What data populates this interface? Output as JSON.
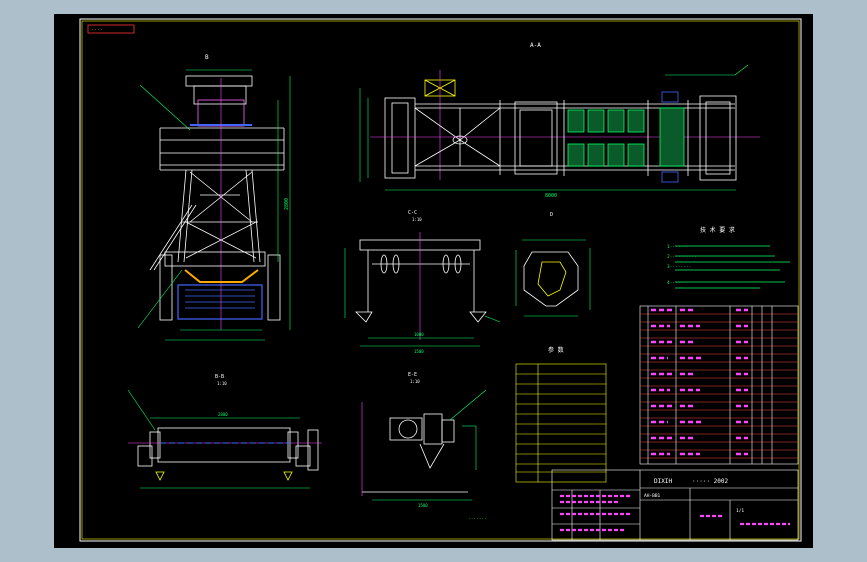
{
  "title_tag": "····",
  "views": {
    "side_label": "B",
    "top_label": "A-A",
    "cc_label": "C-C",
    "dd_label": "D",
    "bb_label": "B-B",
    "ee_label": "E-E",
    "scale": "1:10"
  },
  "dims": {
    "top_total": "8000",
    "side_h": "2800",
    "cc_w1": "1000",
    "cc_w2": "1500",
    "bb_w": "2800",
    "ee_w": "1500"
  },
  "tech_title": "技 术 要 求",
  "tech_notes": [
    "1·······",
    "2··········",
    "3········",
    "4······"
  ],
  "param_title": "参 数",
  "bottom_note": "·······",
  "title_block": {
    "school": "DIXIH",
    "drawing_name": "····· 2002",
    "code": "AH-BB1",
    "sheet": "1/1"
  }
}
